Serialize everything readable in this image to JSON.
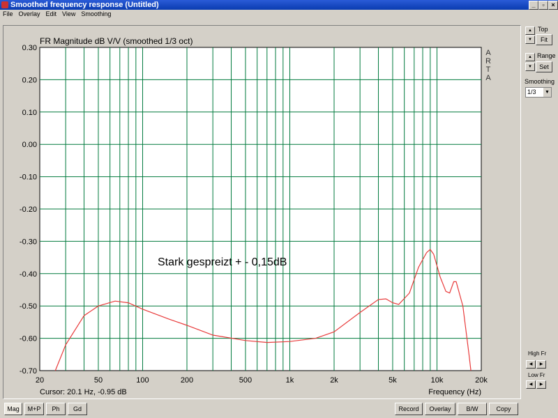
{
  "window": {
    "title": "Smoothed frequency response (Untitled)",
    "min": "_",
    "max": "▫",
    "close": "×"
  },
  "menu": [
    "File",
    "Overlay",
    "Edit",
    "View",
    "Smoothing"
  ],
  "side": {
    "top_label": "Top",
    "fit": "Fit",
    "range_label": "Range",
    "set": "Set",
    "smoothing_label": "Smoothing",
    "smoothing_value": "1/3",
    "high_fr": "High Fr",
    "low_fr": "Low Fr"
  },
  "bottom": {
    "tabs": [
      "Mag",
      "M+P",
      "Ph",
      "Gd"
    ],
    "actions": [
      "Record",
      "Overlay",
      "B/W",
      "Copy"
    ]
  },
  "cursor": "Cursor: 20.1 Hz, -0.95 dB",
  "annotation": "Stark gespreizt + - 0,15dB",
  "colors": {
    "grid": "#007a3d",
    "curve": "#e83a3a"
  },
  "chart_data": {
    "type": "line",
    "title": "FR Magnitude dB V/V (smoothed 1/3 oct)",
    "xlabel": "Frequency (Hz)",
    "ylabel": "",
    "watermark": "ARTA",
    "xscale": "log",
    "xlim": [
      20,
      20000
    ],
    "ylim": [
      -0.7,
      0.3
    ],
    "xticks": [
      20,
      50,
      100,
      200,
      500,
      1000,
      2000,
      5000,
      10000,
      20000
    ],
    "xtick_labels": [
      "20",
      "50",
      "100",
      "200",
      "500",
      "1k",
      "2k",
      "5k",
      "10k",
      "20k"
    ],
    "yticks": [
      "0.30",
      "0.20",
      "0.10",
      "0.00",
      "-0.10",
      "-0.20",
      "-0.30",
      "-0.40",
      "-0.50",
      "-0.60",
      "-0.70"
    ],
    "grid": true,
    "series": [
      {
        "name": "FR",
        "x": [
          25.5,
          30,
          40,
          50,
          65,
          80,
          100,
          150,
          200,
          300,
          500,
          700,
          1000,
          1500,
          2000,
          3000,
          4000,
          4500,
          5000,
          5500,
          6500,
          7500,
          8500,
          9000,
          9500,
          10500,
          11500,
          12200,
          13000,
          13500,
          15000,
          16500,
          17000
        ],
        "y": [
          -0.7,
          -0.62,
          -0.53,
          -0.5,
          -0.485,
          -0.49,
          -0.51,
          -0.54,
          -0.56,
          -0.59,
          -0.607,
          -0.613,
          -0.61,
          -0.6,
          -0.58,
          -0.52,
          -0.48,
          -0.478,
          -0.49,
          -0.495,
          -0.46,
          -0.38,
          -0.335,
          -0.325,
          -0.34,
          -0.41,
          -0.455,
          -0.46,
          -0.425,
          -0.425,
          -0.5,
          -0.65,
          -0.7
        ]
      }
    ]
  }
}
